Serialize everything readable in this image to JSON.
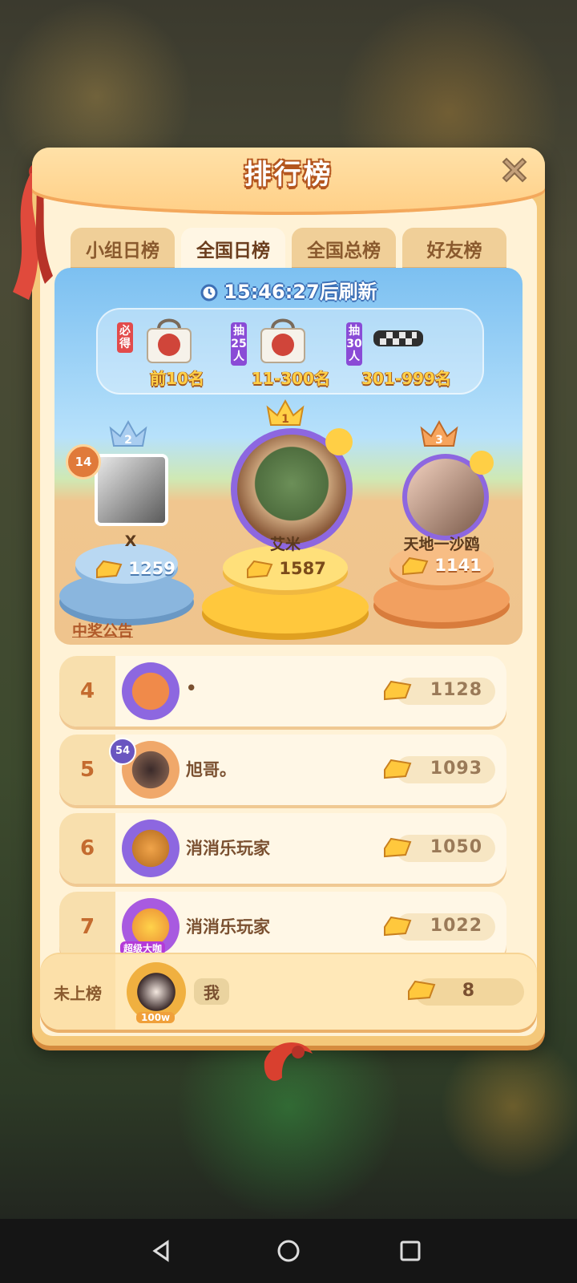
{
  "panel": {
    "title": "排行榜",
    "tabs": [
      {
        "label": "小组日榜",
        "active": false
      },
      {
        "label": "全国日榜",
        "active": true
      },
      {
        "label": "全国总榜",
        "active": false
      },
      {
        "label": "好友榜",
        "active": false
      }
    ],
    "refresh_time": "15:46:27",
    "refresh_suffix": "后刷新",
    "prizes": [
      {
        "tag": "必得",
        "range": "前10名",
        "item_icon": "tote-bag-icon"
      },
      {
        "tag": "抽25人",
        "range": "11-300名",
        "item_icon": "tote-bag-icon"
      },
      {
        "tag": "抽30人",
        "range": "301-999名",
        "item_icon": "waist-bag-icon"
      }
    ],
    "podium": [
      {
        "rank": "2",
        "name": "X",
        "score": "1259",
        "level": "14"
      },
      {
        "rank": "1",
        "name": "艾米",
        "score": "1587"
      },
      {
        "rank": "3",
        "name": "天地一沙鸥",
        "score": "1141"
      }
    ],
    "notice_link": "中奖公告",
    "rows": [
      {
        "rank": "4",
        "name": "•",
        "score": "1128"
      },
      {
        "rank": "5",
        "name": "旭哥。",
        "score": "1093",
        "level": "54"
      },
      {
        "rank": "6",
        "name": "消消乐玩家",
        "score": "1050"
      },
      {
        "rank": "7",
        "name": "消消乐玩家",
        "score": "1022",
        "badge": "超级大咖"
      }
    ],
    "me": {
      "rank": "未上榜",
      "name": "我",
      "score": "8",
      "badge": "100w"
    }
  },
  "colors": {
    "accent": "#f4c87a",
    "gold": "#ffc83d",
    "stage_sky": "#7cc0f1"
  }
}
